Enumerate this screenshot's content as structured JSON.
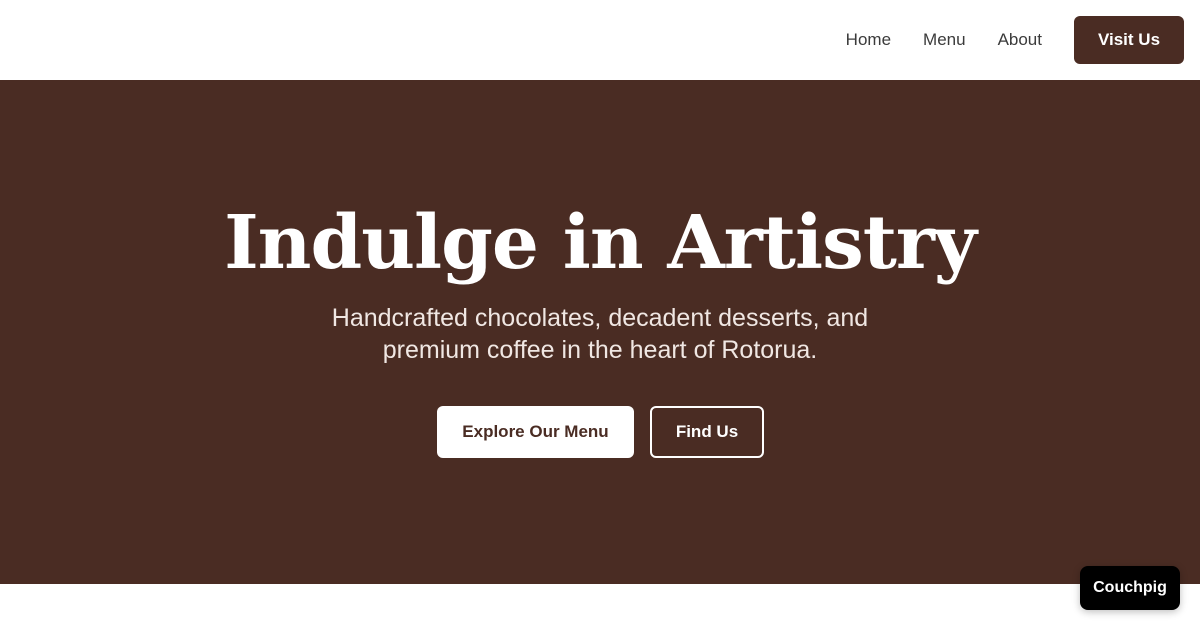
{
  "nav": {
    "links": [
      "Home",
      "Menu",
      "About"
    ],
    "cta_label": "Visit Us"
  },
  "hero": {
    "title": "Indulge in Artistry",
    "subtitle": "Handcrafted chocolates, decadent desserts, and premium coffee in the heart of Rotorua.",
    "primary_button": "Explore Our Menu",
    "secondary_button": "Find Us"
  },
  "badge": {
    "label": "Couchpig"
  },
  "colors": {
    "brand_brown": "#4a2c23",
    "white": "#ffffff",
    "badge_black": "#000000"
  }
}
